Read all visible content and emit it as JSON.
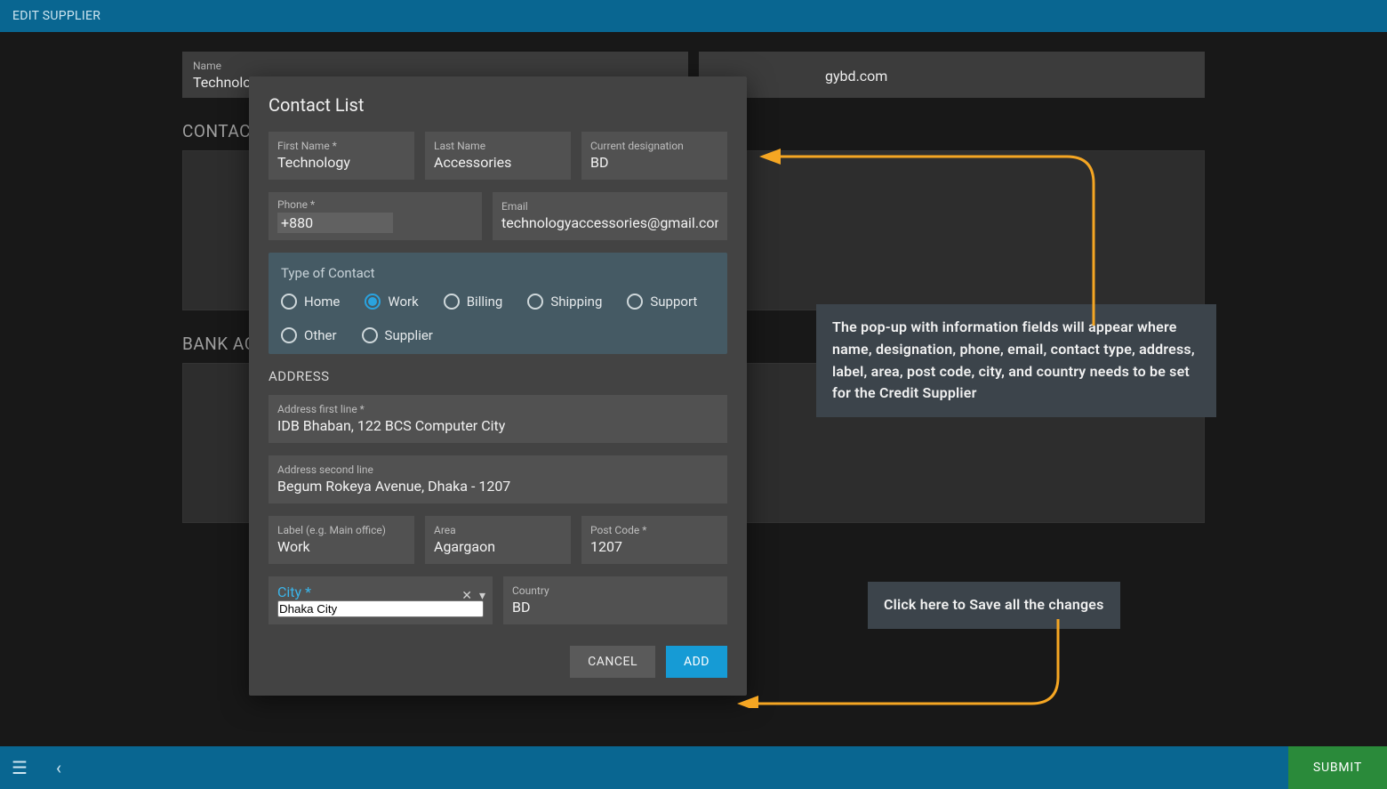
{
  "page": {
    "title": "EDIT SUPPLIER",
    "name_label": "Name",
    "name_value": "Technology Accessories",
    "right_value": "gybd.com",
    "contact_section": "CONTACT",
    "bank_section": "BANK ACCOUNT"
  },
  "modal": {
    "title": "Contact List",
    "first_name": {
      "label": "First Name *",
      "value": "Technology"
    },
    "last_name": {
      "label": "Last Name",
      "value": "Accessories"
    },
    "designation": {
      "label": "Current designation",
      "value": "BD"
    },
    "phone": {
      "label": "Phone *",
      "value": "+880"
    },
    "email": {
      "label": "Email",
      "value": "technologyaccessories@gmail.com"
    },
    "type_title": "Type of Contact",
    "types": [
      "Home",
      "Work",
      "Billing",
      "Shipping",
      "Support",
      "Other",
      "Supplier"
    ],
    "type_selected": "Work",
    "address_title": "ADDRESS",
    "addr1": {
      "label": "Address first line *",
      "value": "IDB Bhaban, 122 BCS Computer City"
    },
    "addr2": {
      "label": "Address second line",
      "value": "Begum Rokeya Avenue, Dhaka - 1207"
    },
    "label_f": {
      "label": "Label (e.g. Main office)",
      "value": "Work"
    },
    "area": {
      "label": "Area",
      "value": "Agargaon"
    },
    "post": {
      "label": "Post Code *",
      "value": "1207"
    },
    "city": {
      "label": "City *",
      "value": "Dhaka City"
    },
    "country": {
      "label": "Country",
      "value": "BD"
    },
    "cancel_label": "CANCEL",
    "add_label": "ADD"
  },
  "callouts": {
    "c1": "The pop-up with information fields will appear where name, designation, phone, email, contact type, address, label, area, post code, city, and country needs to be set for the Credit Supplier",
    "c2": "Click here to Save all the changes"
  },
  "bottombar": {
    "submit": "SUBMIT"
  }
}
